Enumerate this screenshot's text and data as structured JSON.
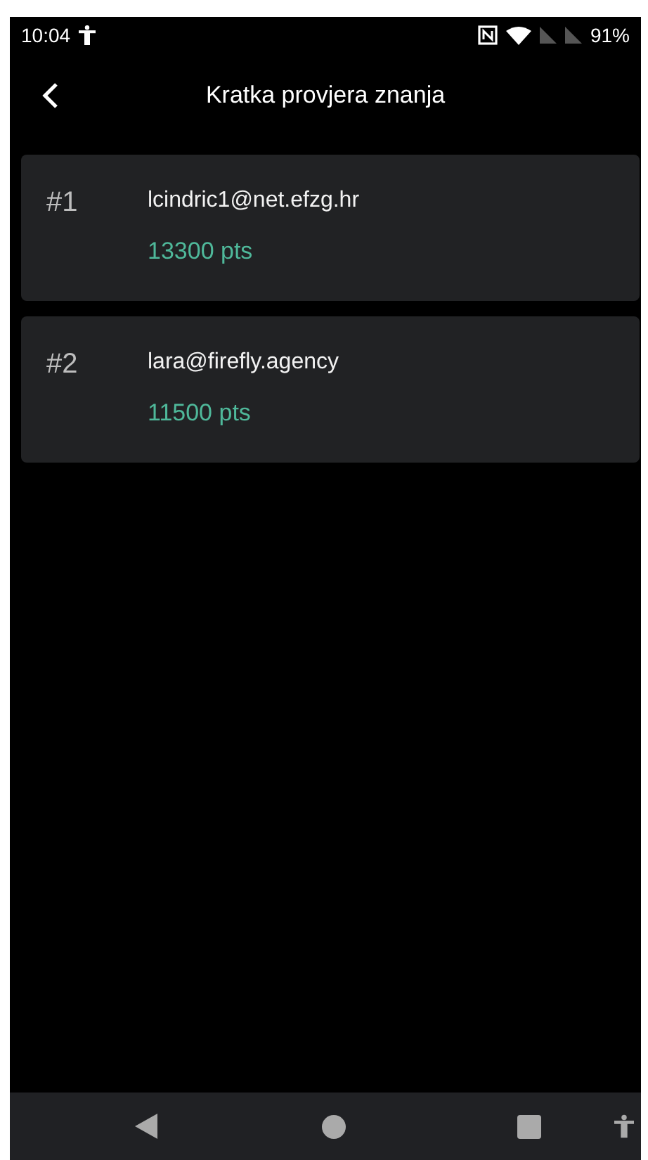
{
  "status_bar": {
    "time": "10:04",
    "battery": "91%"
  },
  "header": {
    "title": "Kratka provjera znanja"
  },
  "leaderboard": [
    {
      "rank": "#1",
      "email": "lcindric1@net.efzg.hr",
      "points": "13300 pts"
    },
    {
      "rank": "#2",
      "email": "lara@firefly.agency",
      "points": "11500 pts"
    }
  ]
}
